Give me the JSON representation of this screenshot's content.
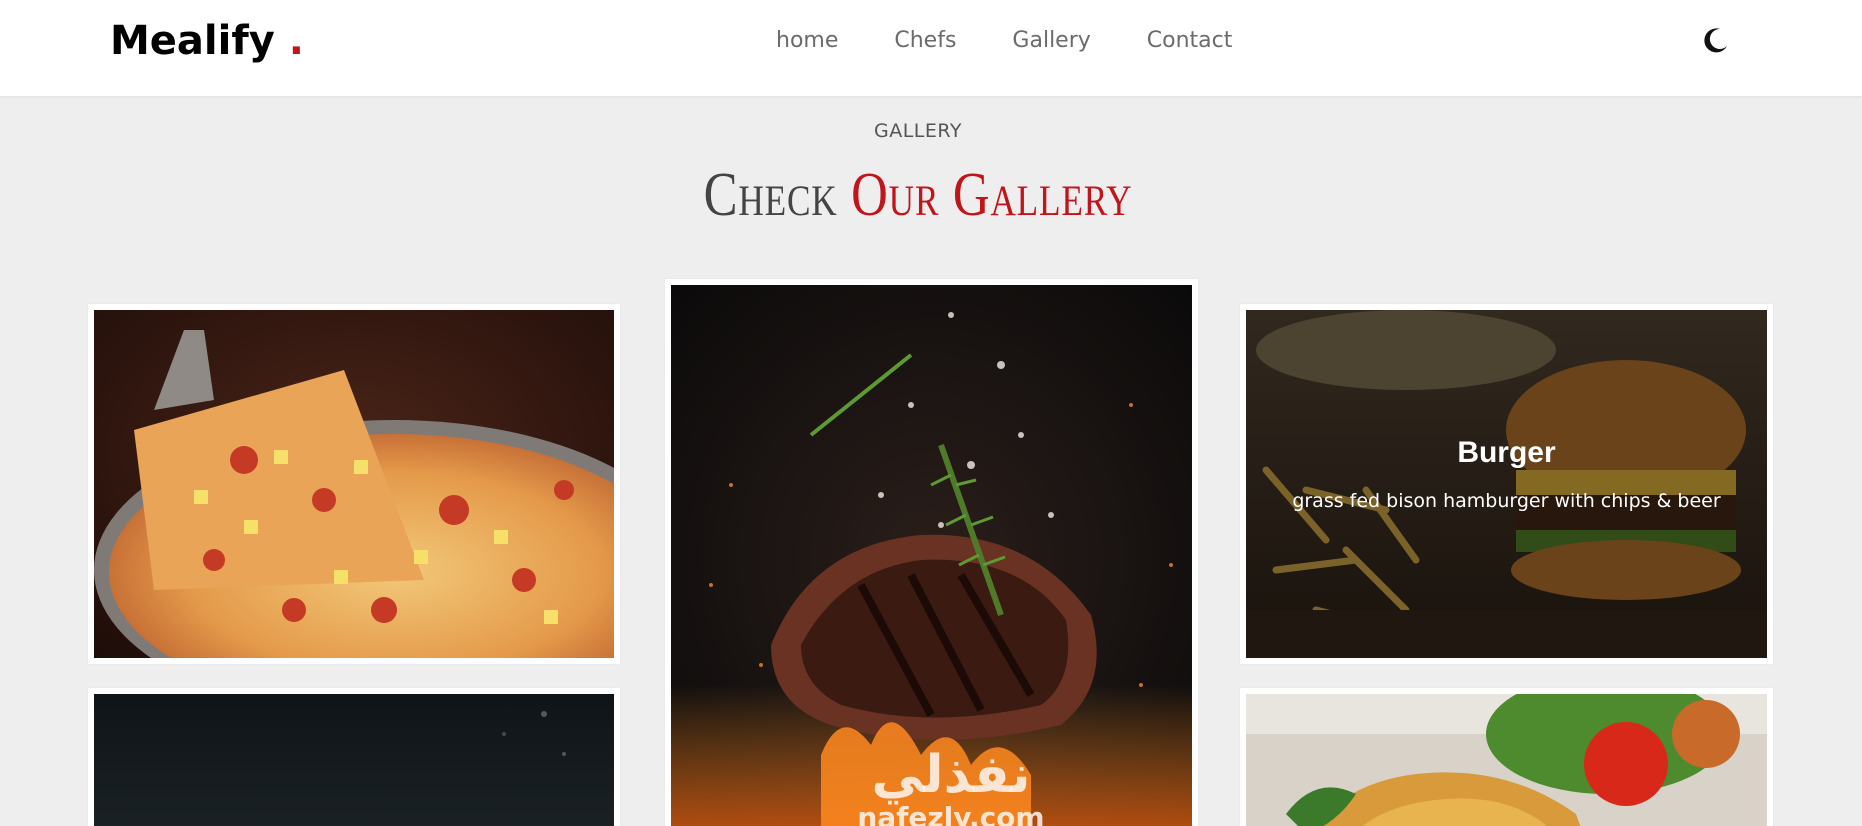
{
  "header": {
    "logo_text": "Mealify",
    "logo_dot": ".",
    "nav": [
      "home",
      "Chefs",
      "Gallery",
      "Contact"
    ],
    "theme_toggle_icon": "moon-icon"
  },
  "section": {
    "label": "GALLERY",
    "title_plain": "Check",
    "title_accent": "Our Gallery"
  },
  "gallery": {
    "items": [
      {
        "image": "pizza"
      },
      {
        "image": "steak"
      },
      {
        "image": "burger",
        "title": "Burger",
        "description": "grass fed bison hamburger with chips & beer"
      },
      {
        "image": "dark-dish"
      },
      {
        "image": "fried-chicken"
      }
    ],
    "watermark": {
      "arabic": "نفذلي",
      "latin": "nafezly.com"
    }
  },
  "colors": {
    "accent": "#c0151b",
    "background": "#eeeeee",
    "header_bg": "#ffffff",
    "nav_text": "#6b6b6b"
  }
}
